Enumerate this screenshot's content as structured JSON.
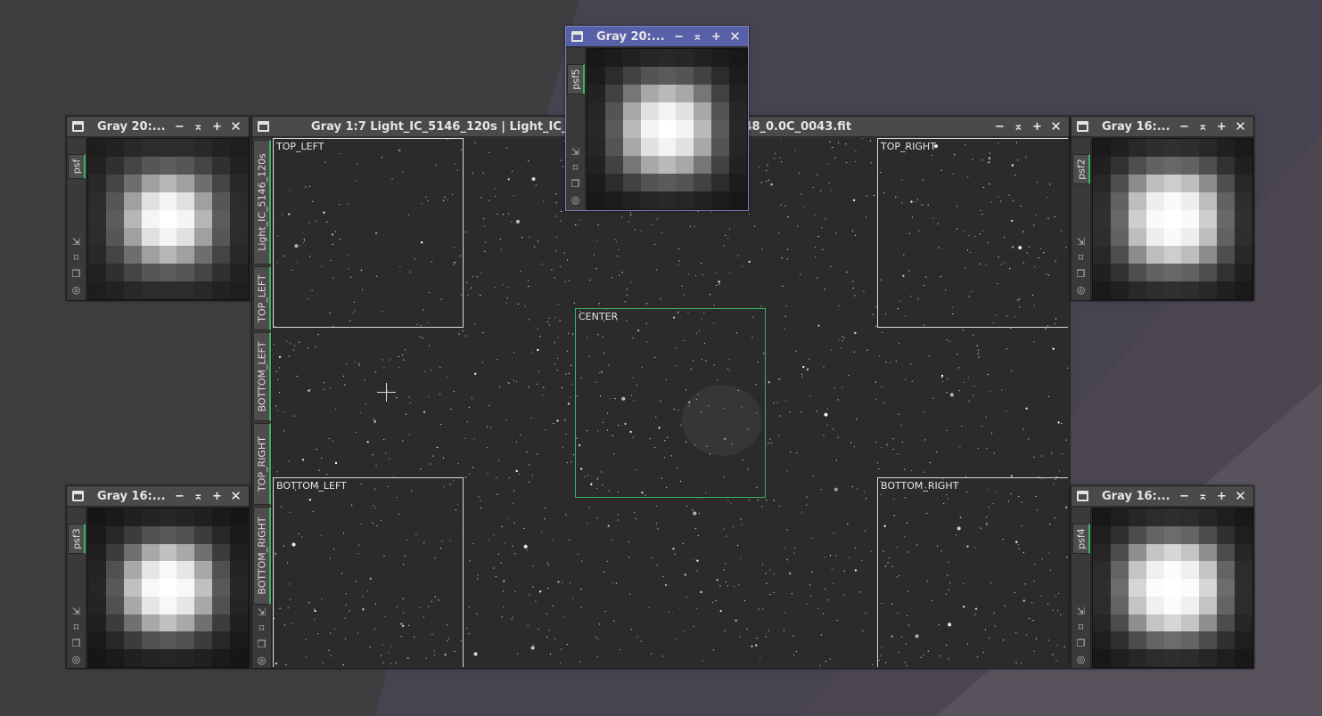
{
  "main_window": {
    "title": "Gray 1:7 Light_IC_5146_120s | Light_IC_5146_120s_20250701-013148_0.0C_0043.fit",
    "view_tabs": [
      "Light_IC_5146_120s",
      "TOP_LEFT",
      "BOTTOM_LEFT",
      "TOP_RIGHT",
      "BOTTOM_RIGHT"
    ],
    "regions": [
      "TOP_LEFT",
      "TOP_RIGHT",
      "CENTER",
      "BOTTOM_LEFT",
      "BOTTOM_RIGHT"
    ]
  },
  "psf_windows": [
    {
      "id": "psf",
      "title": "Gray 20:...",
      "tab": "psf",
      "active": false,
      "pixels": [
        [
          30,
          34,
          40,
          44,
          45,
          44,
          40,
          34,
          30
        ],
        [
          34,
          48,
          68,
          86,
          92,
          86,
          68,
          48,
          34
        ],
        [
          40,
          68,
          110,
          160,
          182,
          160,
          110,
          68,
          40
        ],
        [
          44,
          86,
          160,
          225,
          245,
          225,
          160,
          86,
          44
        ],
        [
          45,
          92,
          182,
          245,
          255,
          245,
          182,
          92,
          45
        ],
        [
          44,
          86,
          160,
          225,
          245,
          225,
          160,
          86,
          44
        ],
        [
          40,
          68,
          110,
          160,
          182,
          160,
          110,
          68,
          40
        ],
        [
          34,
          48,
          68,
          86,
          92,
          86,
          68,
          48,
          34
        ],
        [
          30,
          34,
          40,
          44,
          45,
          44,
          40,
          34,
          30
        ]
      ]
    },
    {
      "id": "psf5",
      "title": "Gray 20:...",
      "tab": "psf5",
      "active": true,
      "pixels": [
        [
          24,
          28,
          34,
          38,
          40,
          38,
          34,
          28,
          24
        ],
        [
          28,
          44,
          66,
          84,
          90,
          84,
          66,
          44,
          28
        ],
        [
          34,
          66,
          118,
          168,
          186,
          168,
          118,
          66,
          34
        ],
        [
          38,
          84,
          168,
          226,
          244,
          226,
          168,
          84,
          38
        ],
        [
          40,
          90,
          186,
          244,
          255,
          244,
          186,
          90,
          40
        ],
        [
          38,
          84,
          168,
          226,
          244,
          226,
          168,
          84,
          38
        ],
        [
          34,
          66,
          118,
          168,
          186,
          168,
          118,
          66,
          34
        ],
        [
          28,
          44,
          66,
          84,
          90,
          84,
          66,
          44,
          28
        ],
        [
          24,
          28,
          34,
          38,
          40,
          38,
          34,
          28,
          24
        ]
      ]
    },
    {
      "id": "psf2",
      "title": "Gray 16:...",
      "tab": "psf2",
      "active": false,
      "pixels": [
        [
          26,
          32,
          40,
          46,
          48,
          46,
          40,
          32,
          26
        ],
        [
          32,
          50,
          78,
          98,
          104,
          98,
          78,
          50,
          32
        ],
        [
          40,
          78,
          140,
          190,
          206,
          190,
          140,
          78,
          40
        ],
        [
          46,
          98,
          190,
          238,
          250,
          238,
          190,
          98,
          46
        ],
        [
          48,
          104,
          206,
          250,
          255,
          250,
          206,
          104,
          48
        ],
        [
          46,
          98,
          190,
          238,
          250,
          238,
          190,
          98,
          46
        ],
        [
          40,
          78,
          140,
          190,
          206,
          190,
          140,
          78,
          40
        ],
        [
          32,
          50,
          78,
          98,
          104,
          98,
          78,
          50,
          32
        ],
        [
          26,
          32,
          40,
          46,
          48,
          46,
          40,
          32,
          26
        ]
      ]
    },
    {
      "id": "psf3",
      "title": "Gray 16:...",
      "tab": "psf3",
      "active": false,
      "pixels": [
        [
          22,
          26,
          32,
          36,
          38,
          36,
          32,
          26,
          22
        ],
        [
          26,
          40,
          60,
          80,
          88,
          80,
          60,
          40,
          26
        ],
        [
          32,
          60,
          112,
          168,
          192,
          168,
          112,
          60,
          32
        ],
        [
          36,
          80,
          168,
          230,
          248,
          230,
          168,
          80,
          36
        ],
        [
          38,
          88,
          192,
          248,
          255,
          248,
          192,
          88,
          38
        ],
        [
          36,
          80,
          168,
          230,
          248,
          230,
          168,
          80,
          36
        ],
        [
          32,
          60,
          112,
          168,
          192,
          168,
          112,
          60,
          32
        ],
        [
          26,
          40,
          60,
          80,
          88,
          80,
          60,
          40,
          26
        ],
        [
          22,
          26,
          32,
          36,
          38,
          36,
          32,
          26,
          22
        ]
      ]
    },
    {
      "id": "psf4",
      "title": "Gray 16:...",
      "tab": "psf4",
      "active": false,
      "pixels": [
        [
          24,
          30,
          38,
          44,
          46,
          44,
          38,
          30,
          24
        ],
        [
          30,
          48,
          76,
          100,
          108,
          100,
          76,
          48,
          30
        ],
        [
          38,
          76,
          142,
          196,
          214,
          196,
          142,
          76,
          38
        ],
        [
          44,
          100,
          196,
          240,
          252,
          240,
          196,
          100,
          44
        ],
        [
          46,
          108,
          214,
          252,
          255,
          252,
          214,
          108,
          46
        ],
        [
          44,
          100,
          196,
          240,
          252,
          240,
          196,
          100,
          44
        ],
        [
          38,
          76,
          142,
          196,
          214,
          196,
          142,
          76,
          38
        ],
        [
          30,
          48,
          76,
          100,
          108,
          100,
          76,
          48,
          30
        ],
        [
          24,
          30,
          38,
          44,
          46,
          44,
          38,
          30,
          24
        ]
      ]
    }
  ],
  "window_controls": {
    "minimize": "−",
    "shade": "⌅",
    "maximize": "+",
    "close": "✕"
  },
  "side_tools": [
    "resize-icon",
    "fit-icon",
    "clone-icon",
    "target-icon"
  ],
  "colors": {
    "active_titlebar": "#5860a8",
    "view_tab_accent": "#3fb268",
    "center_roi": "#38b36a"
  }
}
